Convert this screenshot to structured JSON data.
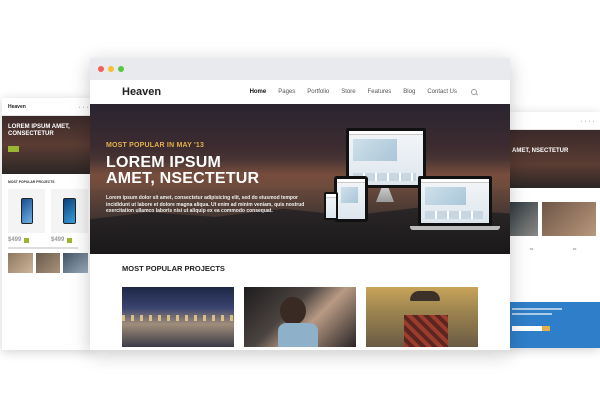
{
  "left_screen": {
    "logo": "Heaven",
    "hero_title": "LOREM IPSUM AMET, CONSECTETUR",
    "section_title": "MOST POPULAR PROJECTS",
    "price_1": "$499",
    "price_2": "$499"
  },
  "browser": {
    "logo": "Heaven",
    "nav": [
      "Home",
      "Pages",
      "Portfolio",
      "Store",
      "Features",
      "Blog",
      "Contact Us"
    ],
    "active_nav": "Home",
    "hero": {
      "kicker": "MOST POPULAR IN MAY '13",
      "headline_line1": "LOREM IPSUM",
      "headline_line2": "AMET, NSECTETUR",
      "blurb": "Lorem ipsum dolor sit amet, consectetur adipisicing elit, sed do eiusmod tempor incididunt ut labore et dolore magna aliqua. Ut enim ad minim veniam, quis nostrud exercitation ullamco laboris nisi ut aliquip ex ea commodo consequat."
    },
    "projects_title": "MOST POPULAR PROJECTS"
  },
  "right_screen": {
    "hero_title": "AMET, NSECTETUR"
  },
  "colors": {
    "accent_gold": "#e3b04b",
    "accent_green": "#9ab534",
    "footer_blue": "#2f7ec9"
  }
}
